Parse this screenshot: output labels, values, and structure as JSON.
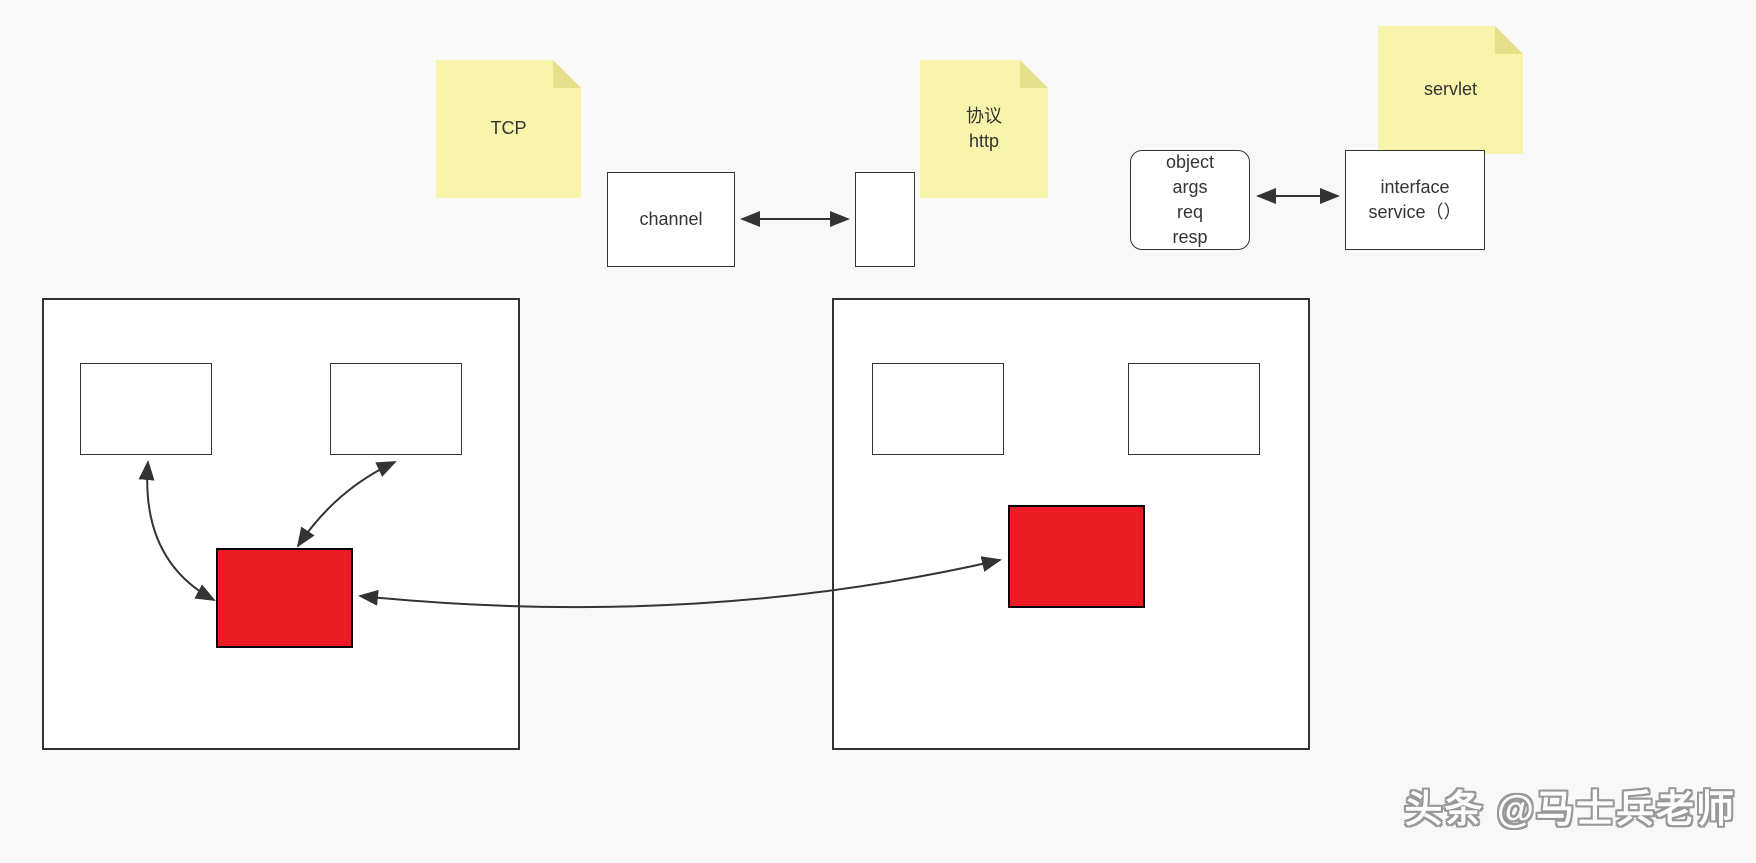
{
  "notes": {
    "tcp": {
      "label": "TCP"
    },
    "http": {
      "line1": "协议",
      "line2": "http"
    },
    "servlet": {
      "label": "servlet"
    }
  },
  "boxes": {
    "channel": {
      "label": "channel"
    },
    "objectargs": {
      "line1": "object",
      "line2": "args",
      "line3": "req",
      "line4": "resp"
    },
    "interface": {
      "line1": "interface",
      "line2": "service（）"
    }
  },
  "watermark": "头条 @马士兵老师"
}
